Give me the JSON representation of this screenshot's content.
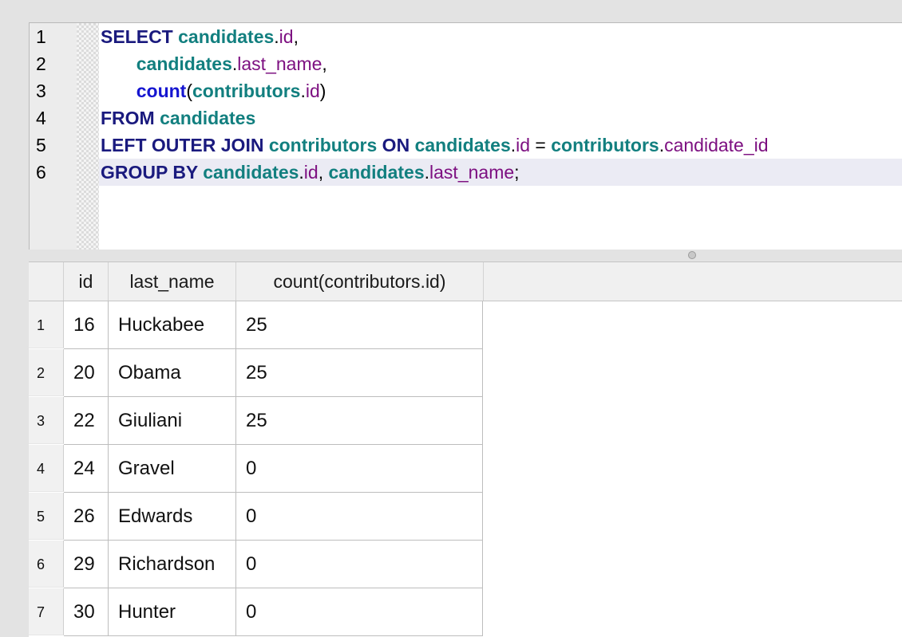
{
  "editor": {
    "line_numbers": [
      "1",
      "2",
      "3",
      "4",
      "5",
      "6"
    ],
    "lines": [
      [
        [
          "kw",
          "SELECT "
        ],
        [
          "tbl",
          "candidates"
        ],
        [
          "pn",
          "."
        ],
        [
          "col",
          "id"
        ],
        [
          "pn",
          ","
        ]
      ],
      [
        [
          "pn",
          "       "
        ],
        [
          "tbl",
          "candidates"
        ],
        [
          "pn",
          "."
        ],
        [
          "col",
          "last_name"
        ],
        [
          "pn",
          ","
        ]
      ],
      [
        [
          "pn",
          "       "
        ],
        [
          "fn",
          "count"
        ],
        [
          "pn",
          "("
        ],
        [
          "tbl",
          "contributors"
        ],
        [
          "pn",
          "."
        ],
        [
          "col",
          "id"
        ],
        [
          "pn",
          ")"
        ]
      ],
      [
        [
          "kw",
          "FROM "
        ],
        [
          "tbl",
          "candidates"
        ]
      ],
      [
        [
          "kw",
          "LEFT OUTER JOIN "
        ],
        [
          "tbl",
          "contributors"
        ],
        [
          "kw",
          " ON "
        ],
        [
          "tbl",
          "candidates"
        ],
        [
          "pn",
          "."
        ],
        [
          "col",
          "id"
        ],
        [
          "pn",
          " = "
        ],
        [
          "tbl",
          "contributors"
        ],
        [
          "pn",
          "."
        ],
        [
          "col",
          "candidate_id"
        ]
      ],
      [
        [
          "kw",
          "GROUP BY "
        ],
        [
          "tbl",
          "candidates"
        ],
        [
          "pn",
          "."
        ],
        [
          "col",
          "id"
        ],
        [
          "pn",
          ", "
        ],
        [
          "tbl",
          "candidates"
        ],
        [
          "pn",
          "."
        ],
        [
          "col",
          "last_name"
        ],
        [
          "pn",
          ";"
        ]
      ]
    ],
    "current_line": 6
  },
  "results": {
    "columns": [
      "id",
      "last_name",
      "count(contributors.id)"
    ],
    "rows": [
      {
        "n": "1",
        "cells": [
          "16",
          "Huckabee",
          "25"
        ]
      },
      {
        "n": "2",
        "cells": [
          "20",
          "Obama",
          "25"
        ]
      },
      {
        "n": "3",
        "cells": [
          "22",
          "Giuliani",
          "25"
        ]
      },
      {
        "n": "4",
        "cells": [
          "24",
          "Gravel",
          "0"
        ]
      },
      {
        "n": "5",
        "cells": [
          "26",
          "Edwards",
          "0"
        ]
      },
      {
        "n": "6",
        "cells": [
          "29",
          "Richardson",
          "0"
        ]
      },
      {
        "n": "7",
        "cells": [
          "30",
          "Hunter",
          "0"
        ]
      }
    ]
  },
  "colors": {
    "keyword": "#1a1a7e",
    "function": "#1515d0",
    "table": "#127f7f",
    "column": "#7d1081",
    "current_line": "#ebebf4"
  }
}
